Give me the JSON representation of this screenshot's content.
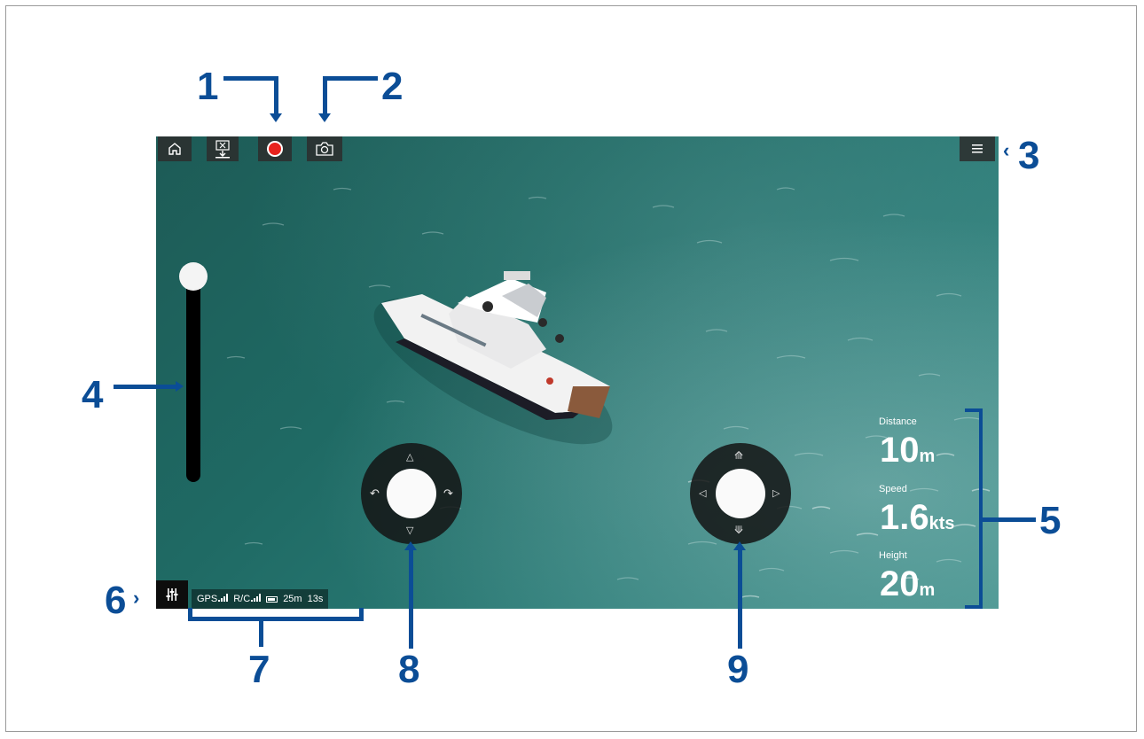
{
  "callouts": {
    "c1": "1",
    "c2": "2",
    "c3": "3",
    "c4": "4",
    "c5": "5",
    "c6": "6",
    "c7": "7",
    "c8": "8",
    "c9": "9"
  },
  "toolbar": {
    "icons": [
      "home-icon",
      "land-drone-icon",
      "record-icon",
      "camera-icon",
      "menu-icon"
    ],
    "record_color": "#e8231e"
  },
  "zoom_slider": {
    "level": 1.0
  },
  "telemetry": {
    "distance_label": "Distance",
    "distance_value": "10",
    "distance_unit": "m",
    "speed_label": "Speed",
    "speed_value": "1.6",
    "speed_unit": "kts",
    "height_label": "Height",
    "height_value": "20",
    "height_unit": "m"
  },
  "status": {
    "gps_label": "GPS",
    "rc_label": "R/C",
    "flight_time_min": "25m",
    "flight_time_sec": "13s"
  },
  "colors": {
    "callout": "#0b4d96",
    "sea": "#1f6a64"
  }
}
